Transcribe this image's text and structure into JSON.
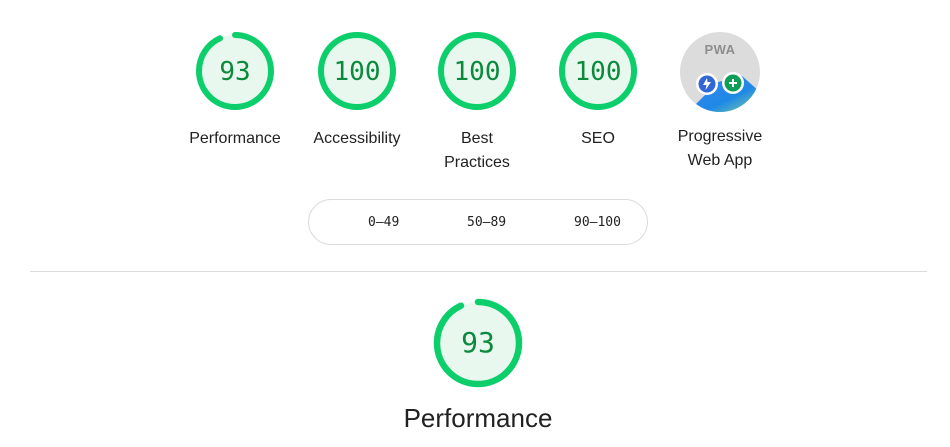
{
  "categories": [
    {
      "score": "93",
      "value": 93,
      "label": "Performance"
    },
    {
      "score": "100",
      "value": 100,
      "label": "Accessibility"
    },
    {
      "score": "100",
      "value": 100,
      "label": "Best Practices"
    },
    {
      "score": "100",
      "value": 100,
      "label": "SEO"
    }
  ],
  "pwa": {
    "badge_text": "PWA",
    "label": "Progressive Web App"
  },
  "legend": {
    "ranges": [
      "0–49",
      "50–89",
      "90–100"
    ]
  },
  "section": {
    "score": "93",
    "value": 93,
    "title": "Performance"
  },
  "colors": {
    "pass": "#0cce6b",
    "pass_text": "#0b8a3c",
    "pass_fill": "#e8f8ef",
    "pwa_gray": "#dcdcdc"
  }
}
